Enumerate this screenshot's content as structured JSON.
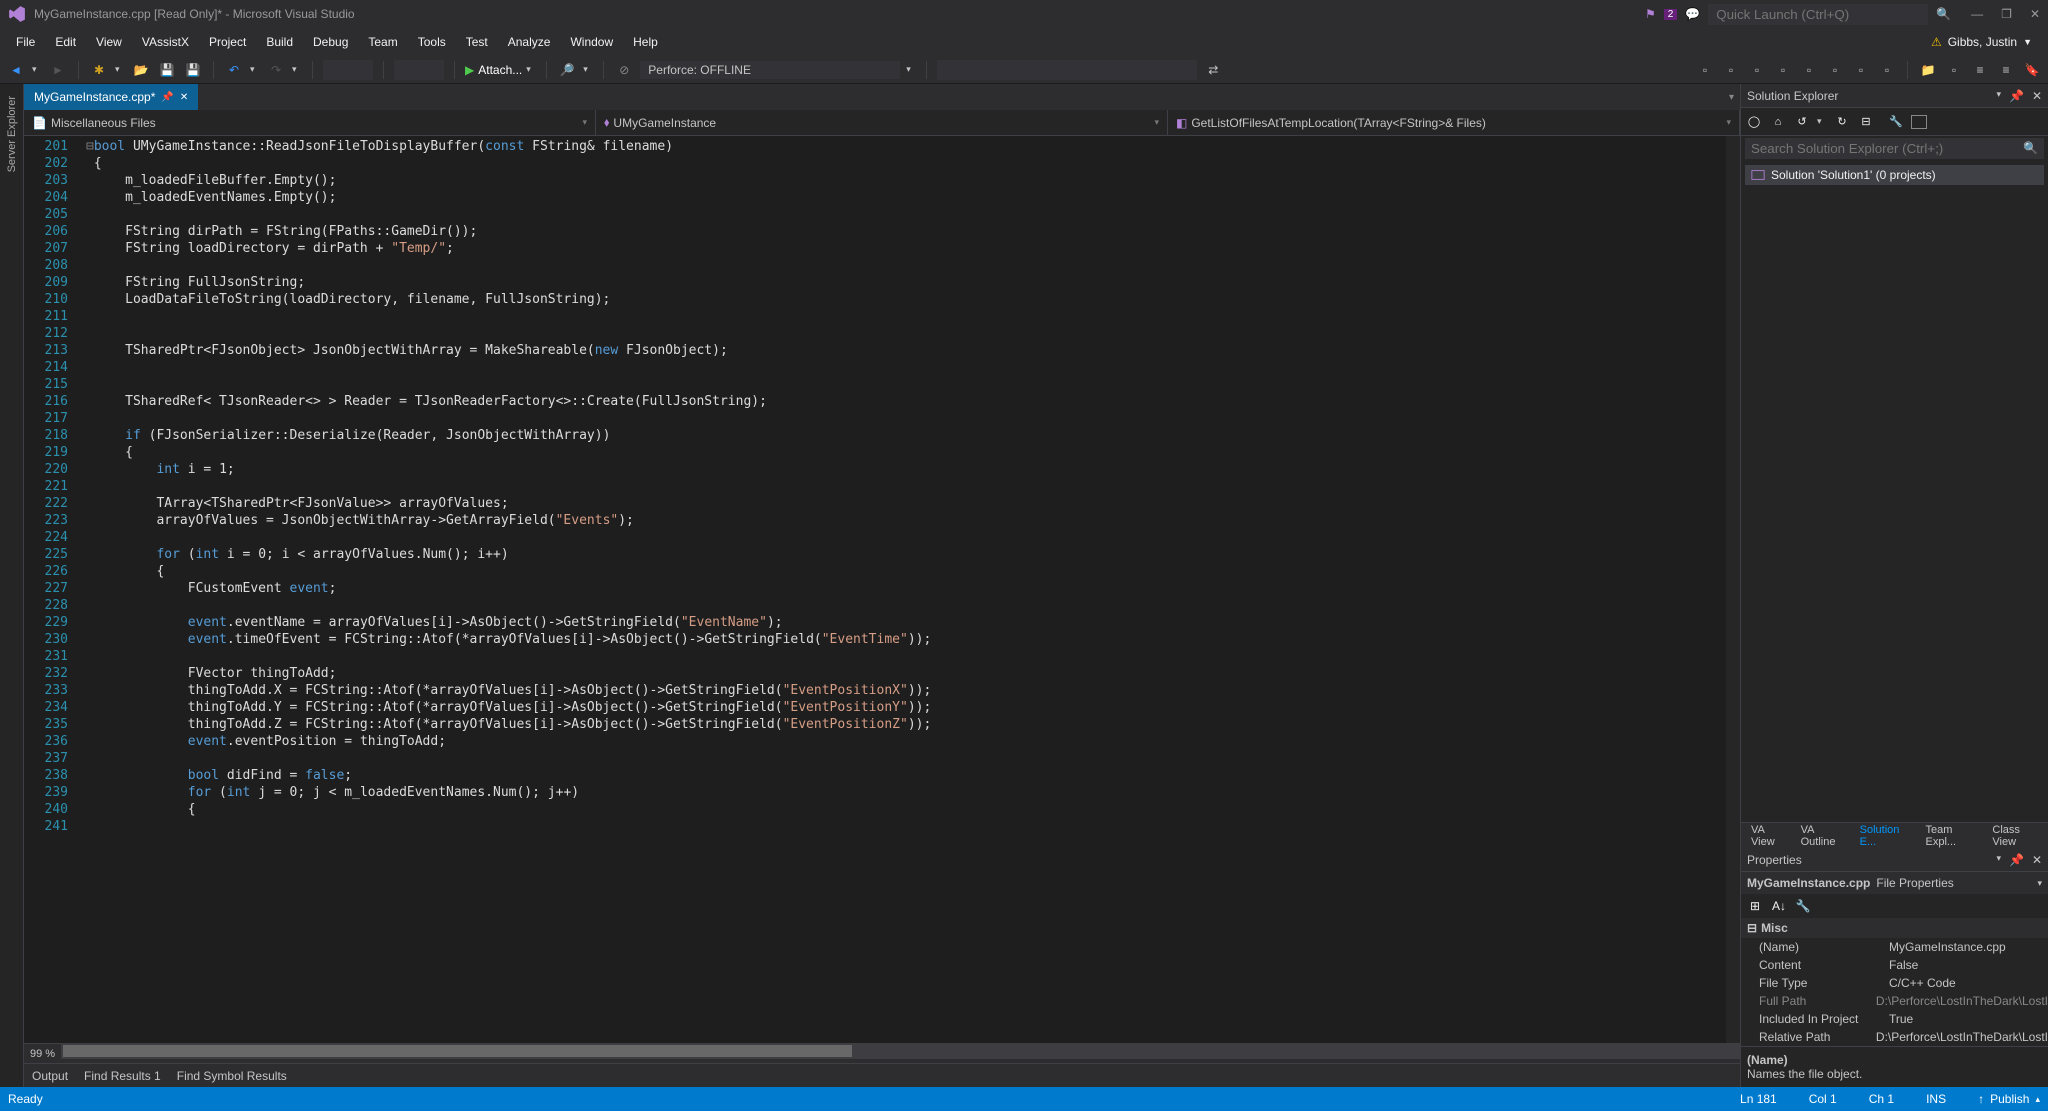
{
  "title": "MyGameInstance.cpp [Read Only]* - Microsoft Visual Studio",
  "quick_launch_placeholder": "Quick Launch (Ctrl+Q)",
  "notif_count": "2",
  "user_name": "Gibbs, Justin",
  "menu": {
    "file": "File",
    "edit": "Edit",
    "view": "View",
    "vassistx": "VAssistX",
    "project": "Project",
    "build": "Build",
    "debug": "Debug",
    "team": "Team",
    "tools": "Tools",
    "test": "Test",
    "analyze": "Analyze",
    "window": "Window",
    "help": "Help"
  },
  "toolbar": {
    "attach": "Attach...",
    "perforce": "Perforce: OFFLINE"
  },
  "doc_tab": {
    "name": "MyGameInstance.cpp*"
  },
  "nav": {
    "scope": "Miscellaneous Files",
    "class": "UMyGameInstance",
    "member": "GetListOfFilesAtTempLocation(TArray<FString>& Files)"
  },
  "line_start": 201,
  "line_end": 241,
  "zoom": "99 %",
  "bottom_tabs": {
    "output": "Output",
    "find": "Find Results 1",
    "symbol": "Find Symbol Results"
  },
  "status": {
    "ready": "Ready",
    "ln": "Ln 181",
    "col": "Col 1",
    "ch": "Ch 1",
    "ins": "INS",
    "publish": "Publish"
  },
  "solution_explorer": {
    "title": "Solution Explorer",
    "search_placeholder": "Search Solution Explorer (Ctrl+;)",
    "root": "Solution 'Solution1' (0 projects)",
    "tabs": {
      "va_view": "VA View",
      "va_outline": "VA Outline",
      "solution": "Solution E...",
      "team": "Team Expl...",
      "class": "Class View"
    }
  },
  "properties": {
    "title": "Properties",
    "subject": "MyGameInstance.cpp",
    "subject_type": "File Properties",
    "category": "Misc",
    "rows": [
      {
        "name": "(Name)",
        "val": "MyGameInstance.cpp"
      },
      {
        "name": "Content",
        "val": "False"
      },
      {
        "name": "File Type",
        "val": "C/C++ Code"
      },
      {
        "name": "Full Path",
        "val": "D:\\Perforce\\LostInTheDark\\LostI",
        "dim": true
      },
      {
        "name": "Included In Project",
        "val": "True"
      },
      {
        "name": "Relative Path",
        "val": "D:\\Perforce\\LostInTheDark\\LostI"
      }
    ],
    "desc_title": "(Name)",
    "desc_text": "Names the file object."
  },
  "vertical_tab": "Server Explorer"
}
